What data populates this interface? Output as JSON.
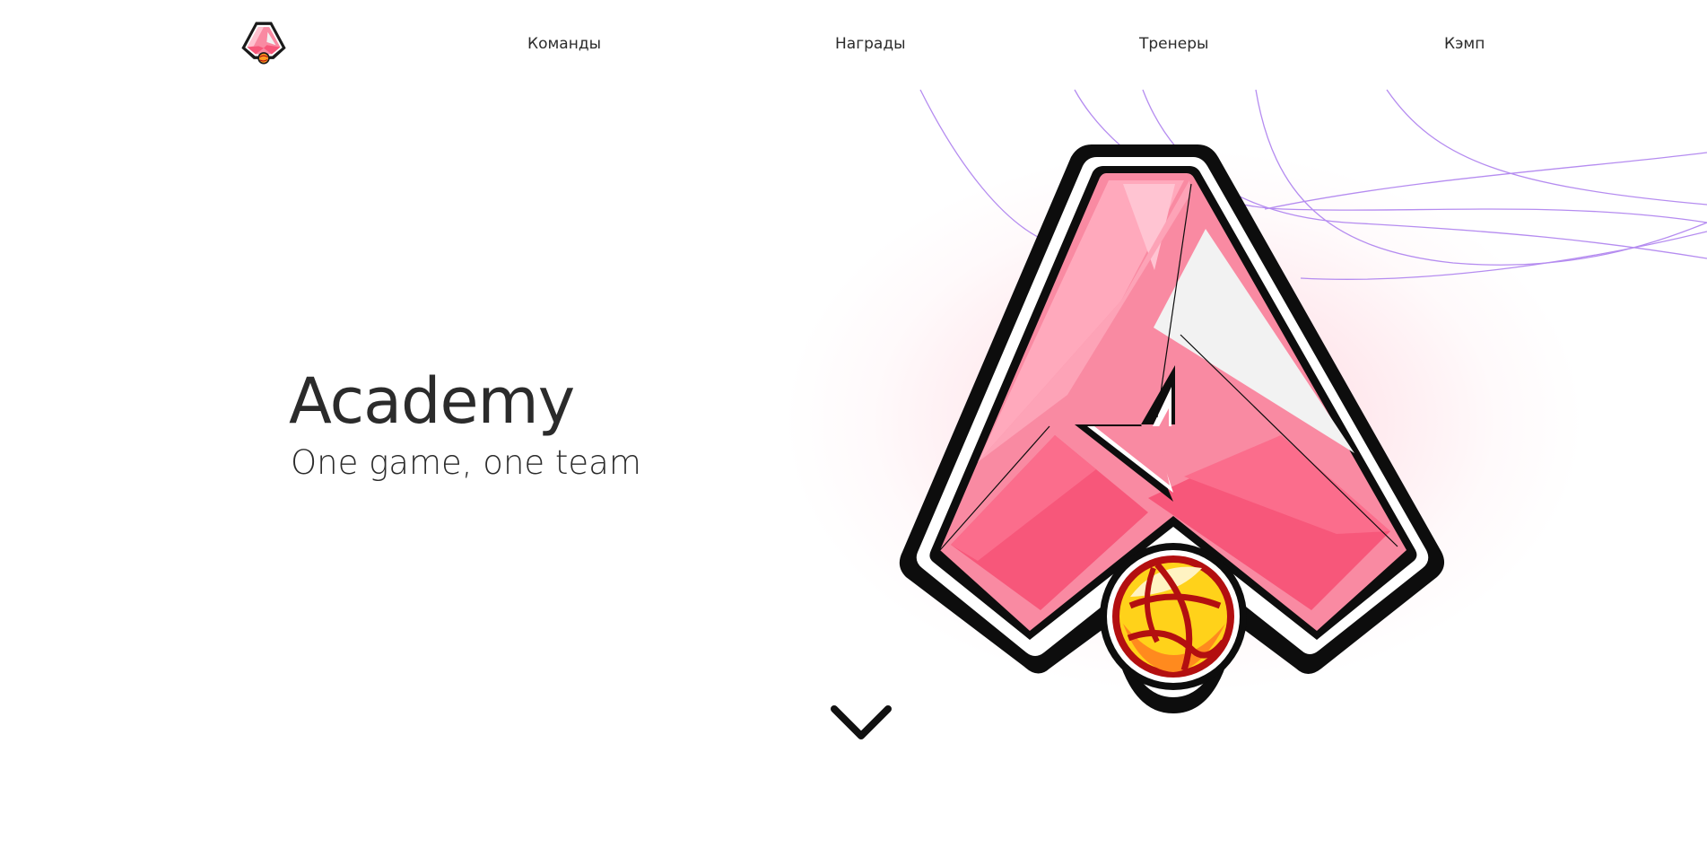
{
  "nav": {
    "logo_icon": "academy-logo-icon",
    "links": [
      {
        "label": "Команды"
      },
      {
        "label": "Награды"
      },
      {
        "label": "Тренеры"
      },
      {
        "label": "Кэмп"
      }
    ]
  },
  "hero": {
    "title": "Academy",
    "subtitle": "One game, one team",
    "emblem_icon": "academy-emblem-basketball-icon",
    "scroll_icon": "chevron-down-icon"
  },
  "colors": {
    "background": "#ffffff",
    "text": "#2b2b2b",
    "accent_pink": "#f7577a",
    "light_pink": "#ffb7c8",
    "lines_purple": "#b58cf0",
    "ball_red": "#b30f10",
    "ball_yellow": "#ffd21a"
  }
}
